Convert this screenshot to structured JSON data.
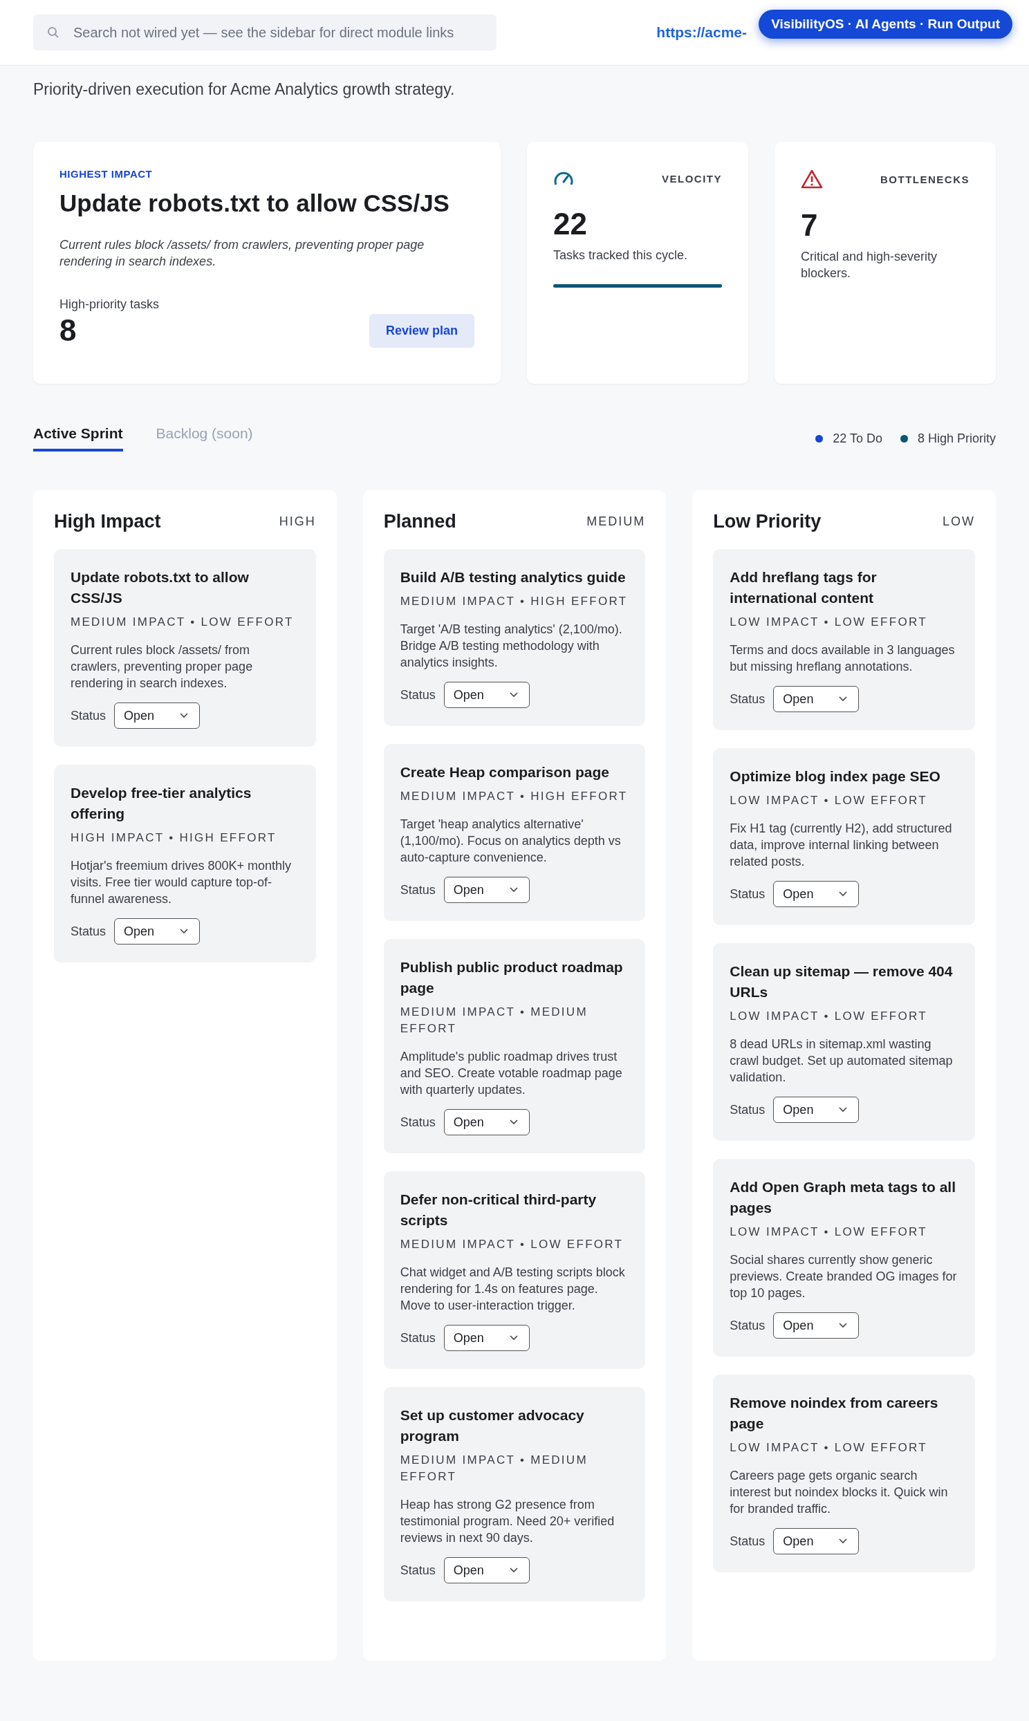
{
  "header": {
    "search_placeholder": "Search not wired yet — see the sidebar for direct module links",
    "url": "https://acme-",
    "badge": "VisibilityOS · AI Agents · Run Output"
  },
  "page": {
    "subtitle": "Priority-driven execution for Acme Analytics growth strategy."
  },
  "highlight": {
    "eyebrow": "HIGHEST IMPACT",
    "title": "Update robots.txt to allow CSS/JS",
    "description": "Current rules block /assets/ from crawlers, preventing proper page rendering in search indexes.",
    "count_label": "High-priority tasks",
    "count": "8",
    "button": "Review plan"
  },
  "metrics": [
    {
      "kind": "velocity",
      "label": "VELOCITY",
      "value": "22",
      "caption": "Tasks tracked this cycle.",
      "level": 1
    },
    {
      "kind": "bottlenecks",
      "label": "BOTTLENECKS",
      "value": "7",
      "caption": "Critical and high-severity blockers."
    }
  ],
  "tabs": [
    {
      "label": "Active Sprint",
      "selected": true,
      "disabled": false
    },
    {
      "label": "Backlog (soon)",
      "selected": false,
      "disabled": true
    }
  ],
  "summary": [
    {
      "label": "22 To Do",
      "color": "#1747d4"
    },
    {
      "label": "8 High Priority",
      "color": "#0b5677"
    }
  ],
  "columns": [
    {
      "title": "High Impact",
      "tag": "HIGH",
      "tasks": [
        {
          "title": "Update robots.txt to allow CSS/JS",
          "meta": "MEDIUM IMPACT • LOW EFFORT",
          "description": "Current rules block /assets/ from crawlers, preventing proper page rendering in search indexes.",
          "status_label": "Status",
          "status": "Open"
        },
        {
          "title": "Develop free-tier analytics offering",
          "meta": "HIGH IMPACT • HIGH EFFORT",
          "description": "Hotjar's freemium drives 800K+ monthly visits. Free tier would capture top-of-funnel awareness.",
          "status_label": "Status",
          "status": "Open"
        }
      ]
    },
    {
      "title": "Planned",
      "tag": "MEDIUM",
      "tasks": [
        {
          "title": "Build A/B testing analytics guide",
          "meta": "MEDIUM IMPACT • HIGH EFFORT",
          "description": "Target 'A/B testing analytics' (2,100/mo). Bridge A/B testing methodology with analytics insights.",
          "status_label": "Status",
          "status": "Open"
        },
        {
          "title": "Create Heap comparison page",
          "meta": "MEDIUM IMPACT • HIGH EFFORT",
          "description": "Target 'heap analytics alternative' (1,100/mo). Focus on analytics depth vs auto-capture convenience.",
          "status_label": "Status",
          "status": "Open"
        },
        {
          "title": "Publish public product roadmap page",
          "meta": "MEDIUM IMPACT • MEDIUM EFFORT",
          "description": "Amplitude's public roadmap drives trust and SEO. Create votable roadmap page with quarterly updates.",
          "status_label": "Status",
          "status": "Open"
        },
        {
          "title": "Defer non-critical third-party scripts",
          "meta": "MEDIUM IMPACT • LOW EFFORT",
          "description": "Chat widget and A/B testing scripts block rendering for 1.4s on features page. Move to user-interaction trigger.",
          "status_label": "Status",
          "status": "Open"
        },
        {
          "title": "Set up customer advocacy program",
          "meta": "MEDIUM IMPACT • MEDIUM EFFORT",
          "description": "Heap has strong G2 presence from testimonial program. Need 20+ verified reviews in next 90 days.",
          "status_label": "Status",
          "status": "Open"
        }
      ]
    },
    {
      "title": "Low Priority",
      "tag": "LOW",
      "tasks": [
        {
          "title": "Add hreflang tags for international content",
          "meta": "LOW IMPACT • LOW EFFORT",
          "description": "Terms and docs available in 3 languages but missing hreflang annotations.",
          "status_label": "Status",
          "status": "Open"
        },
        {
          "title": "Optimize blog index page SEO",
          "meta": "LOW IMPACT • LOW EFFORT",
          "description": "Fix H1 tag (currently H2), add structured data, improve internal linking between related posts.",
          "status_label": "Status",
          "status": "Open"
        },
        {
          "title": "Clean up sitemap — remove 404 URLs",
          "meta": "LOW IMPACT • LOW EFFORT",
          "description": "8 dead URLs in sitemap.xml wasting crawl budget. Set up automated sitemap validation.",
          "status_label": "Status",
          "status": "Open"
        },
        {
          "title": "Add Open Graph meta tags to all pages",
          "meta": "LOW IMPACT • LOW EFFORT",
          "description": "Social shares currently show generic previews. Create branded OG images for top 10 pages.",
          "status_label": "Status",
          "status": "Open"
        },
        {
          "title": "Remove noindex from careers page",
          "meta": "LOW IMPACT • LOW EFFORT",
          "description": "Careers page gets organic search interest but noindex blocks it. Quick win for branded traffic.",
          "status_label": "Status",
          "status": "Open"
        }
      ]
    }
  ]
}
